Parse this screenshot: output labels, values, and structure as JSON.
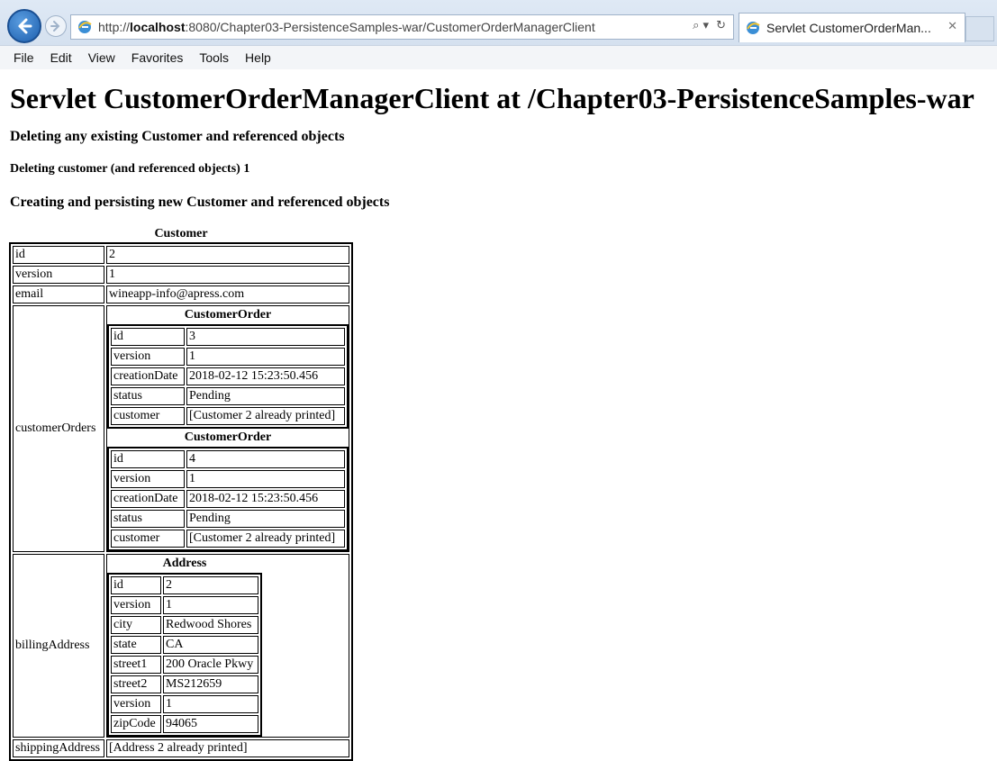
{
  "browser": {
    "url_prefix": "http://",
    "url_host": "localhost",
    "url_rest": ":8080/Chapter03-PersistenceSamples-war/CustomerOrderManagerClient",
    "tab_title": "Servlet CustomerOrderMan...",
    "menu": [
      "File",
      "Edit",
      "View",
      "Favorites",
      "Tools",
      "Help"
    ]
  },
  "page": {
    "title": "Servlet CustomerOrderManagerClient at /Chapter03-PersistenceSamples-war",
    "deleting_heading": "Deleting any existing Customer and referenced objects",
    "deleting_customer": "Deleting customer (and referenced objects) 1",
    "creating_heading": "Creating and persisting new Customer and referenced objects"
  },
  "customer": {
    "caption": "Customer",
    "rows": [
      {
        "key": "id",
        "value": "2"
      },
      {
        "key": "version",
        "value": "1"
      },
      {
        "key": "email",
        "value": "wineapp-info@apress.com"
      }
    ],
    "orders_key": "customerOrders",
    "orders": [
      {
        "caption": "CustomerOrder",
        "rows": [
          {
            "key": "id",
            "value": "3"
          },
          {
            "key": "version",
            "value": "1"
          },
          {
            "key": "creationDate",
            "value": "2018-02-12 15:23:50.456"
          },
          {
            "key": "status",
            "value": "Pending"
          },
          {
            "key": "customer",
            "value": "[Customer 2 already printed]"
          }
        ]
      },
      {
        "caption": "CustomerOrder",
        "rows": [
          {
            "key": "id",
            "value": "4"
          },
          {
            "key": "version",
            "value": "1"
          },
          {
            "key": "creationDate",
            "value": "2018-02-12 15:23:50.456"
          },
          {
            "key": "status",
            "value": "Pending"
          },
          {
            "key": "customer",
            "value": "[Customer 2 already printed]"
          }
        ]
      }
    ],
    "billing_key": "billingAddress",
    "billing": {
      "caption": "Address",
      "rows": [
        {
          "key": "id",
          "value": "2"
        },
        {
          "key": "version",
          "value": "1"
        },
        {
          "key": "city",
          "value": "Redwood Shores"
        },
        {
          "key": "state",
          "value": "CA"
        },
        {
          "key": "street1",
          "value": "200 Oracle Pkwy"
        },
        {
          "key": "street2",
          "value": "MS212659"
        },
        {
          "key": "version",
          "value": "1"
        },
        {
          "key": "zipCode",
          "value": "94065"
        }
      ]
    },
    "shipping_key": "shippingAddress",
    "shipping_value": "[Address 2 already printed]"
  }
}
